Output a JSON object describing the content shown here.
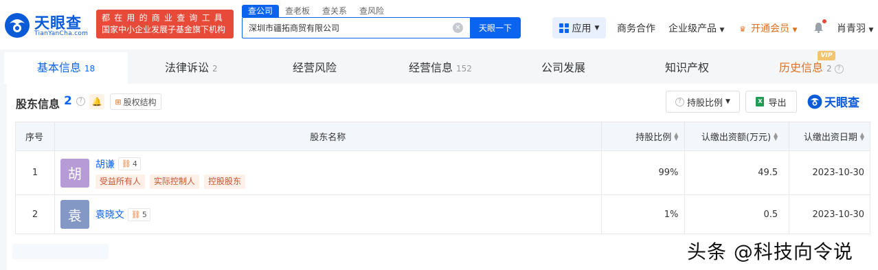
{
  "header": {
    "logo_text": "天眼查",
    "logo_sub": "TianYanCha.com",
    "slogan_line1": "都在用的商业查询工具",
    "slogan_line2": "国家中小企业发展子基金旗下机构",
    "search_tabs": [
      "查公司",
      "查老板",
      "查关系",
      "查风险"
    ],
    "search_value": "深圳市疆拓商贸有限公司",
    "search_button": "天眼一下",
    "apps_label": "应用",
    "nav": {
      "business": "商务合作",
      "enterprise": "企业级产品",
      "vip": "开通会员",
      "user": "肖青羽"
    }
  },
  "tabs": [
    {
      "label": "基本信息",
      "count": "18"
    },
    {
      "label": "法律诉讼",
      "count": "2"
    },
    {
      "label": "经营风险",
      "count": ""
    },
    {
      "label": "经营信息",
      "count": "152"
    },
    {
      "label": "公司发展",
      "count": ""
    },
    {
      "label": "知识产权",
      "count": ""
    },
    {
      "label": "历史信息",
      "count": "2"
    }
  ],
  "vip_badge": "VIP",
  "section": {
    "title": "股东信息",
    "count": "2",
    "equity_button": "股权结构",
    "ratio_button": "持股比例",
    "export_button": "导出",
    "brand": "天眼查"
  },
  "table": {
    "headers": {
      "index": "序号",
      "name": "股东名称",
      "ratio": "持股比例",
      "amount": "认缴出资额(万元)",
      "date": "认缴出资日期"
    },
    "rows": [
      {
        "index": "1",
        "avatar_char": "胡",
        "avatar_color": "#b79bd6",
        "name": "胡谦",
        "relations": "4",
        "tags": [
          "受益所有人",
          "实际控制人",
          "控股股东"
        ],
        "ratio": "99%",
        "amount": "49.5",
        "date": "2023-10-30"
      },
      {
        "index": "2",
        "avatar_char": "袁",
        "avatar_color": "#8398c4",
        "name": "袁晓文",
        "relations": "5",
        "tags": [],
        "ratio": "1%",
        "amount": "0.5",
        "date": "2023-10-30"
      }
    ]
  },
  "watermark": "头条 @科技向令说",
  "colors": {
    "brand_blue": "#0b64f0",
    "slogan_red": "#e84a39",
    "vip_orange": "#e07020",
    "tag_text": "#c9542e"
  }
}
